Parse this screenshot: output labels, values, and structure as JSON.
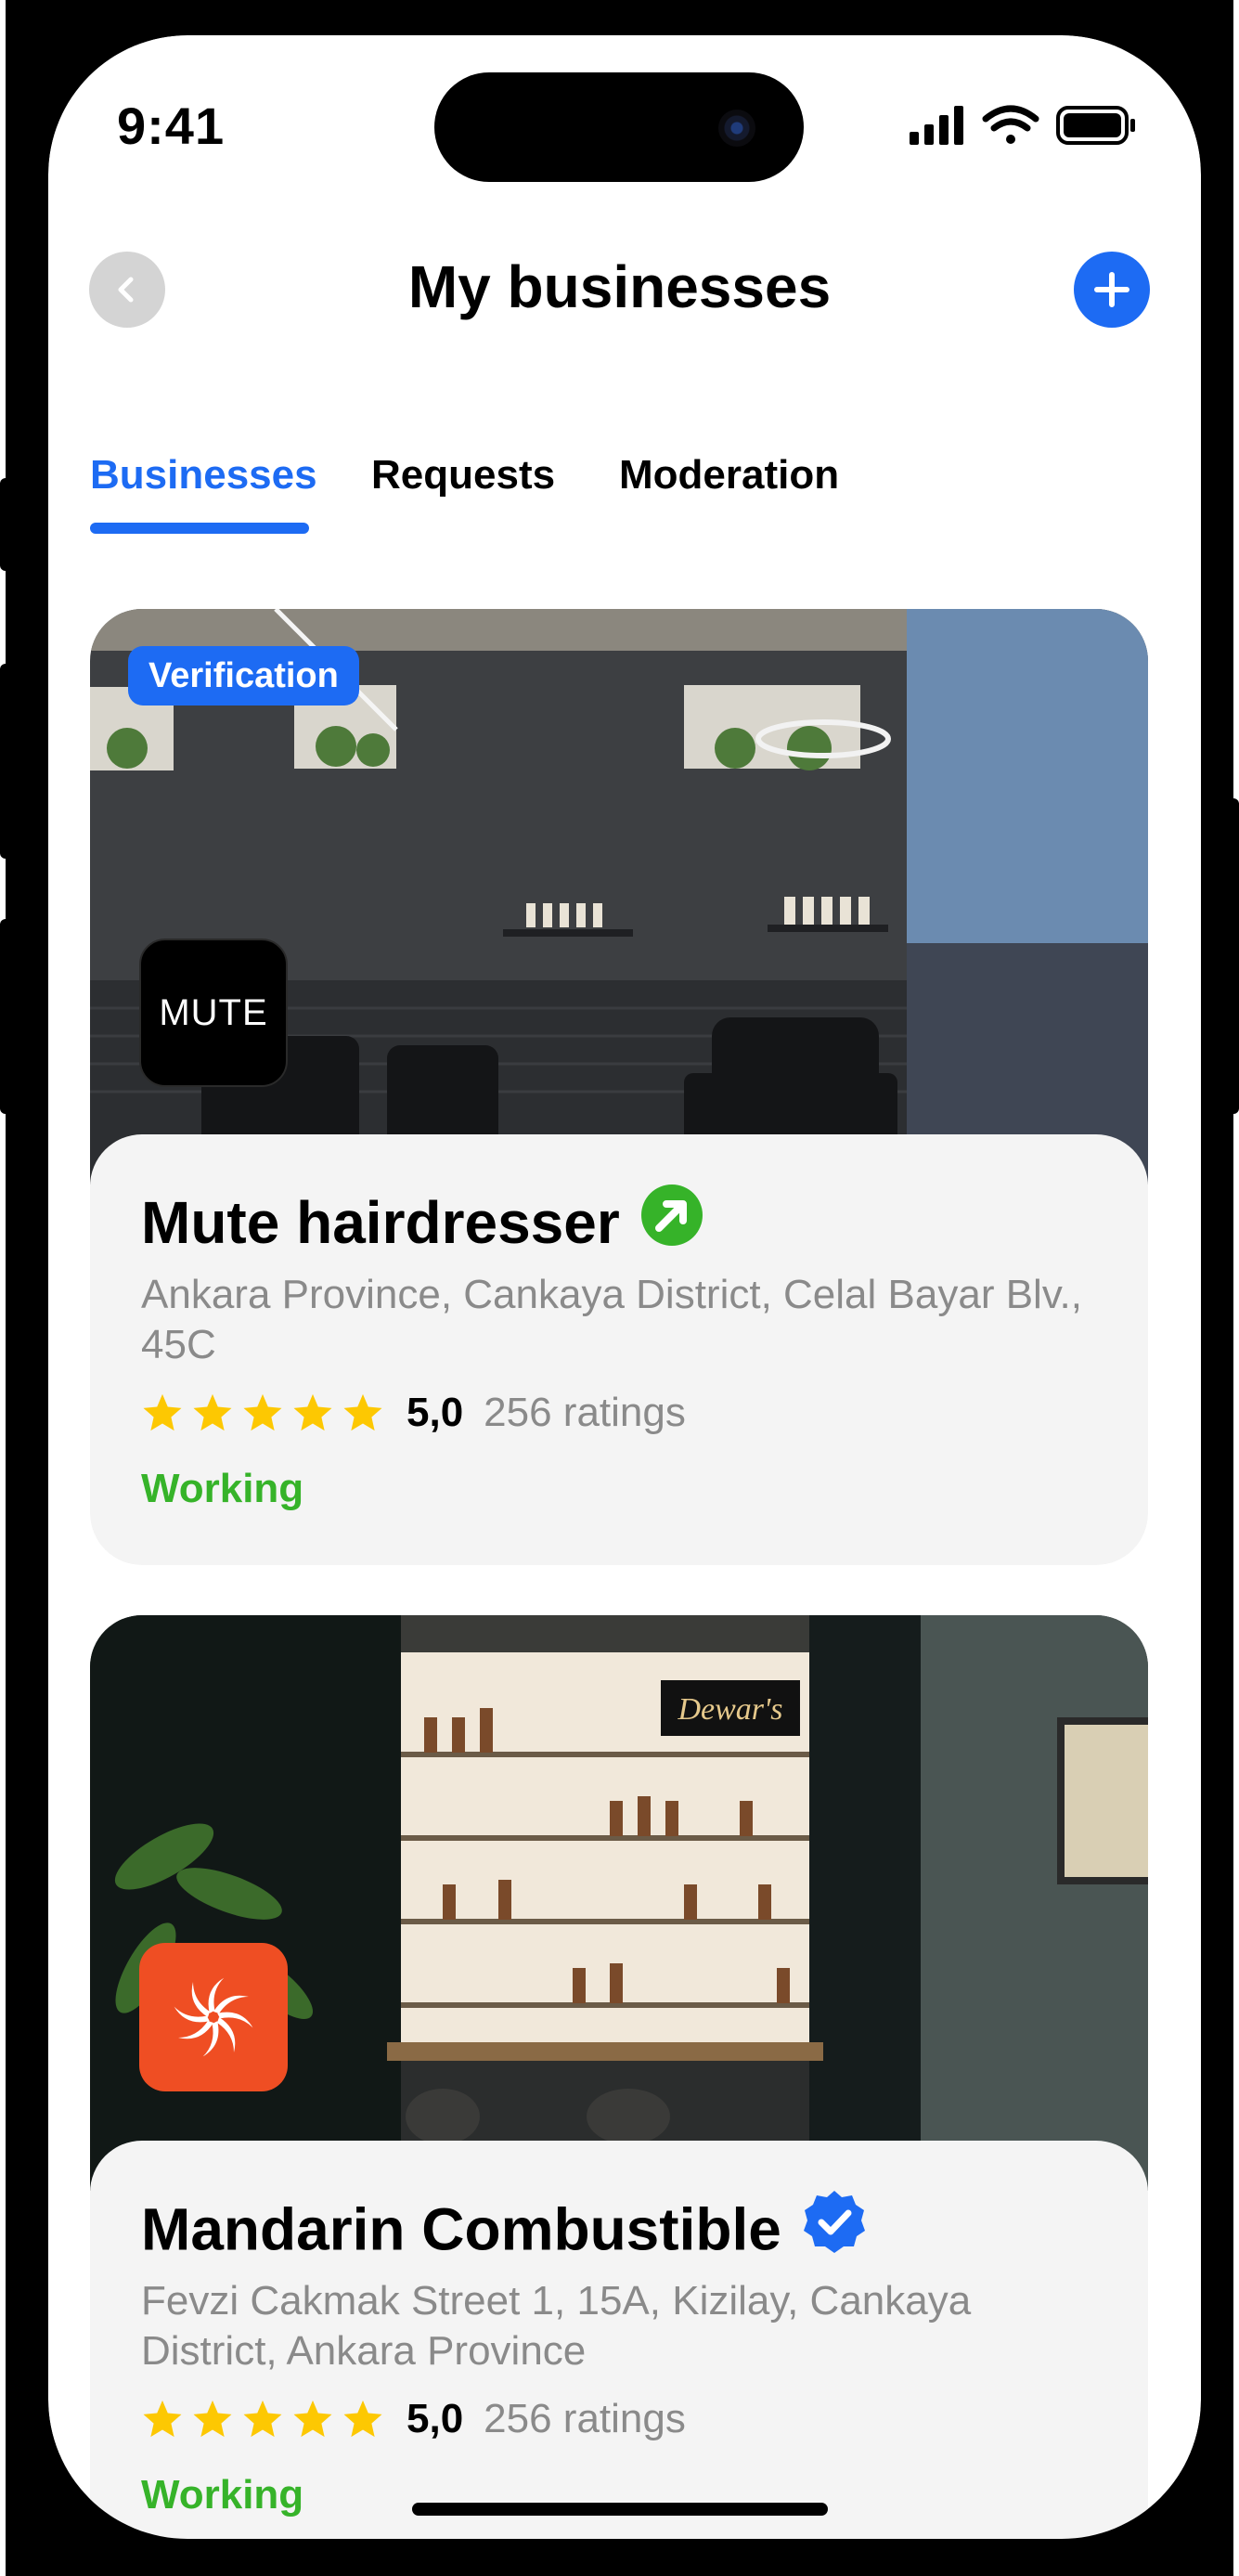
{
  "status_bar": {
    "time": "9:41"
  },
  "header": {
    "title": "My businesses",
    "back_icon": "chevron-left-icon",
    "add_icon": "plus-icon"
  },
  "tabs": [
    {
      "label": "Businesses",
      "active": true
    },
    {
      "label": "Requests",
      "active": false
    },
    {
      "label": "Moderation",
      "active": false
    }
  ],
  "businesses": [
    {
      "name": "Mute hairdresser",
      "badge_icon": "arrow-up-right-icon",
      "badge_color": "#36b329",
      "address": "Ankara Province, Cankaya District, Celal Bayar Blv., 45C",
      "rating": "5,0",
      "stars": 5,
      "ratings_count": "256 ratings",
      "status": "Working",
      "chip": "Verification",
      "logo_text": "MUTE",
      "logo_color": "#000000",
      "photo": "salon-interior-photo"
    },
    {
      "name": "Mandarin Combustible",
      "badge_icon": "verified-check-icon",
      "badge_color": "#1d6bf3",
      "address": "Fevzi Cakmak Street 1, 15A, Kizilay, Cankaya District, Ankara Province",
      "rating": "5,0",
      "stars": 5,
      "ratings_count": "256 ratings",
      "status": "Working",
      "logo_text": "",
      "logo_color": "#ef4e23",
      "photo": "bar-interior-photo"
    }
  ],
  "colors": {
    "accent": "#1d6bf3",
    "working": "#36b329",
    "star": "#fdc802"
  }
}
